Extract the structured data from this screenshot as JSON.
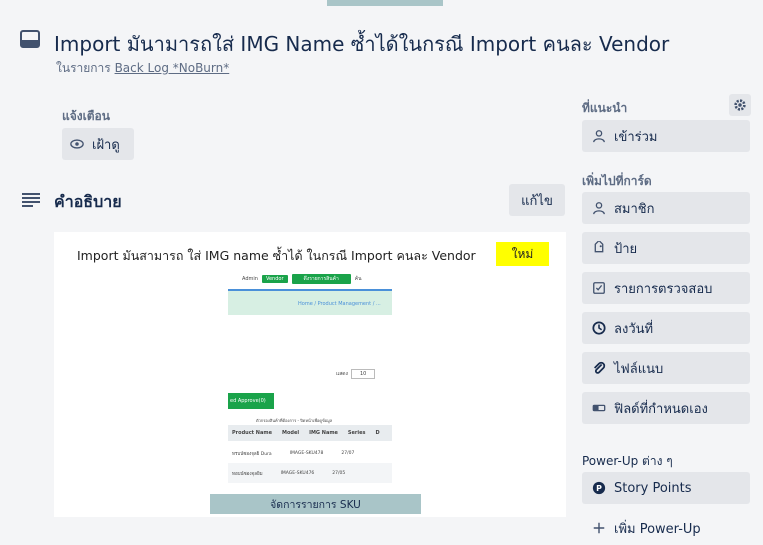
{
  "card": {
    "title": "Import มันามารถใส่ IMG Name ซ้ำได้ในกรณี Import คนละ Vendor",
    "list_prefix": "ในรายการ",
    "list_name": "Back Log *NoBurn*"
  },
  "notifications": {
    "label": "แจ้งเตือน",
    "watch_label": "เฝ้าดู"
  },
  "description": {
    "title": "คำอธิบาย",
    "edit_label": "แก้ไข",
    "text": "Import มันสามารถ ใส่ IMG name ซ้ำได้ ในกรณี Import คนละ Vendor",
    "badge": "ใหม่",
    "image_caption": "จัดการรายการ SKU",
    "screenshot": {
      "admin": "Admin",
      "vendor": "Vendor",
      "green_button": "ดึงรายการสินค้า",
      "right_text": "ค้น",
      "breadcrumb": "Home / Product Management / ...",
      "show_label": "แสดง",
      "show_value": "10",
      "approve_button": "ed Approve(0)",
      "hint": "ตัวกรองสินค้าที่ต้องการ - ปิดหน้าเพื่อดูข้อมูล",
      "columns": [
        "Product Name",
        "Model",
        "IMG Name",
        "Series",
        "D"
      ],
      "rows": [
        [
          "หรบน์ซองจุลยิ Dura",
          "",
          "IMAGE-SKU478",
          "27/07"
        ],
        [
          "ทอบน์ซองจุลยิม",
          "",
          "IMAGE-SKU476",
          "27/05"
        ]
      ]
    }
  },
  "sidebar": {
    "suggested_label": "ที่แนะนำ",
    "join_label": "เข้าร่วม",
    "add_to_card_label": "เพิ่มไปที่การ์ด",
    "members_label": "สมาชิก",
    "labels_label": "ป้าย",
    "checklist_label": "รายการตรวจสอบ",
    "dates_label": "ลงวันที่",
    "attachment_label": "ไฟล์แนบ",
    "custom_fields_label": "ฟิลด์ที่กำหนดเอง",
    "powerups_label": "Power-Up ต่าง ๆ",
    "story_points_label": "Story Points",
    "add_powerup_label": "เพิ่ม Power-Up"
  },
  "colors": {
    "background": "#f4f5f7",
    "button": "#e4e6ea",
    "text": "#172b4d",
    "muted": "#5e6c84",
    "badge": "#ffff00",
    "sku_bar": "#a9c5c8"
  }
}
